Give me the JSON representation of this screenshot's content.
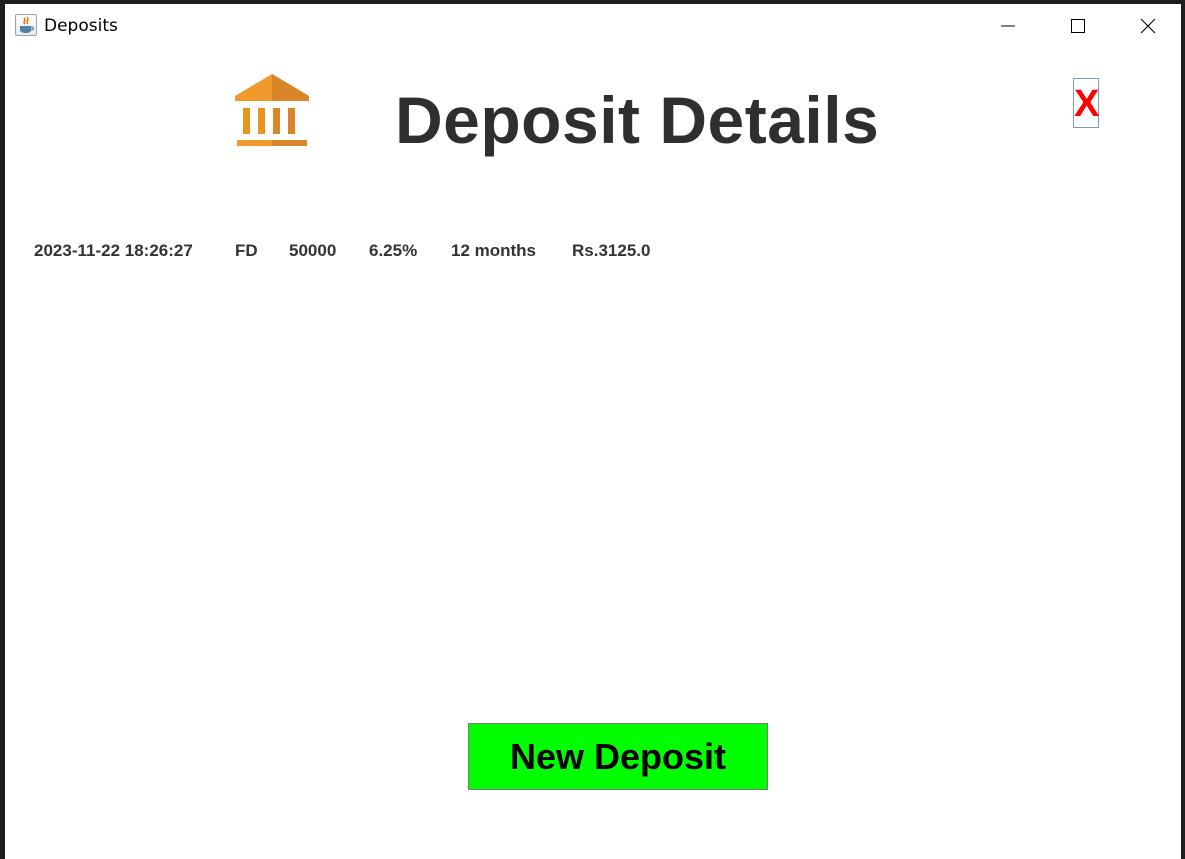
{
  "window": {
    "title": "Deposits",
    "controls": [
      "minimize-icon",
      "maximize-icon",
      "close-icon"
    ]
  },
  "header": {
    "icon": "bank-icon",
    "title": "Deposit Details",
    "close_label": "X"
  },
  "deposits": [
    {
      "datetime": "2023-11-22 18:26:27",
      "type": "FD",
      "amount": "50000",
      "rate": "6.25%",
      "term": "12 months",
      "interest": "Rs.3125.0"
    }
  ],
  "actions": {
    "new_deposit_label": "New Deposit"
  },
  "colors": {
    "accent_green": "#00ff00",
    "close_red": "#ff0000",
    "bank_orange": "#e8941f",
    "heading_text": "#2f2f2f"
  }
}
